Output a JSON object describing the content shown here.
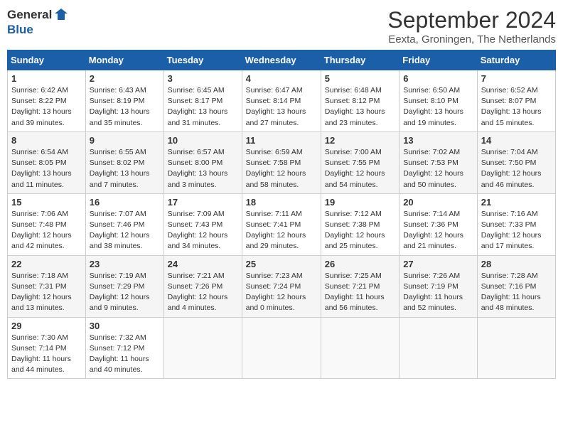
{
  "logo": {
    "line1": "General",
    "line2": "Blue"
  },
  "title": "September 2024",
  "location": "Eexta, Groningen, The Netherlands",
  "weekdays": [
    "Sunday",
    "Monday",
    "Tuesday",
    "Wednesday",
    "Thursday",
    "Friday",
    "Saturday"
  ],
  "weeks": [
    [
      {
        "day": "1",
        "info": "Sunrise: 6:42 AM\nSunset: 8:22 PM\nDaylight: 13 hours\nand 39 minutes."
      },
      {
        "day": "2",
        "info": "Sunrise: 6:43 AM\nSunset: 8:19 PM\nDaylight: 13 hours\nand 35 minutes."
      },
      {
        "day": "3",
        "info": "Sunrise: 6:45 AM\nSunset: 8:17 PM\nDaylight: 13 hours\nand 31 minutes."
      },
      {
        "day": "4",
        "info": "Sunrise: 6:47 AM\nSunset: 8:14 PM\nDaylight: 13 hours\nand 27 minutes."
      },
      {
        "day": "5",
        "info": "Sunrise: 6:48 AM\nSunset: 8:12 PM\nDaylight: 13 hours\nand 23 minutes."
      },
      {
        "day": "6",
        "info": "Sunrise: 6:50 AM\nSunset: 8:10 PM\nDaylight: 13 hours\nand 19 minutes."
      },
      {
        "day": "7",
        "info": "Sunrise: 6:52 AM\nSunset: 8:07 PM\nDaylight: 13 hours\nand 15 minutes."
      }
    ],
    [
      {
        "day": "8",
        "info": "Sunrise: 6:54 AM\nSunset: 8:05 PM\nDaylight: 13 hours\nand 11 minutes."
      },
      {
        "day": "9",
        "info": "Sunrise: 6:55 AM\nSunset: 8:02 PM\nDaylight: 13 hours\nand 7 minutes."
      },
      {
        "day": "10",
        "info": "Sunrise: 6:57 AM\nSunset: 8:00 PM\nDaylight: 13 hours\nand 3 minutes."
      },
      {
        "day": "11",
        "info": "Sunrise: 6:59 AM\nSunset: 7:58 PM\nDaylight: 12 hours\nand 58 minutes."
      },
      {
        "day": "12",
        "info": "Sunrise: 7:00 AM\nSunset: 7:55 PM\nDaylight: 12 hours\nand 54 minutes."
      },
      {
        "day": "13",
        "info": "Sunrise: 7:02 AM\nSunset: 7:53 PM\nDaylight: 12 hours\nand 50 minutes."
      },
      {
        "day": "14",
        "info": "Sunrise: 7:04 AM\nSunset: 7:50 PM\nDaylight: 12 hours\nand 46 minutes."
      }
    ],
    [
      {
        "day": "15",
        "info": "Sunrise: 7:06 AM\nSunset: 7:48 PM\nDaylight: 12 hours\nand 42 minutes."
      },
      {
        "day": "16",
        "info": "Sunrise: 7:07 AM\nSunset: 7:46 PM\nDaylight: 12 hours\nand 38 minutes."
      },
      {
        "day": "17",
        "info": "Sunrise: 7:09 AM\nSunset: 7:43 PM\nDaylight: 12 hours\nand 34 minutes."
      },
      {
        "day": "18",
        "info": "Sunrise: 7:11 AM\nSunset: 7:41 PM\nDaylight: 12 hours\nand 29 minutes."
      },
      {
        "day": "19",
        "info": "Sunrise: 7:12 AM\nSunset: 7:38 PM\nDaylight: 12 hours\nand 25 minutes."
      },
      {
        "day": "20",
        "info": "Sunrise: 7:14 AM\nSunset: 7:36 PM\nDaylight: 12 hours\nand 21 minutes."
      },
      {
        "day": "21",
        "info": "Sunrise: 7:16 AM\nSunset: 7:33 PM\nDaylight: 12 hours\nand 17 minutes."
      }
    ],
    [
      {
        "day": "22",
        "info": "Sunrise: 7:18 AM\nSunset: 7:31 PM\nDaylight: 12 hours\nand 13 minutes."
      },
      {
        "day": "23",
        "info": "Sunrise: 7:19 AM\nSunset: 7:29 PM\nDaylight: 12 hours\nand 9 minutes."
      },
      {
        "day": "24",
        "info": "Sunrise: 7:21 AM\nSunset: 7:26 PM\nDaylight: 12 hours\nand 4 minutes."
      },
      {
        "day": "25",
        "info": "Sunrise: 7:23 AM\nSunset: 7:24 PM\nDaylight: 12 hours\nand 0 minutes."
      },
      {
        "day": "26",
        "info": "Sunrise: 7:25 AM\nSunset: 7:21 PM\nDaylight: 11 hours\nand 56 minutes."
      },
      {
        "day": "27",
        "info": "Sunrise: 7:26 AM\nSunset: 7:19 PM\nDaylight: 11 hours\nand 52 minutes."
      },
      {
        "day": "28",
        "info": "Sunrise: 7:28 AM\nSunset: 7:16 PM\nDaylight: 11 hours\nand 48 minutes."
      }
    ],
    [
      {
        "day": "29",
        "info": "Sunrise: 7:30 AM\nSunset: 7:14 PM\nDaylight: 11 hours\nand 44 minutes."
      },
      {
        "day": "30",
        "info": "Sunrise: 7:32 AM\nSunset: 7:12 PM\nDaylight: 11 hours\nand 40 minutes."
      },
      {
        "day": "",
        "info": ""
      },
      {
        "day": "",
        "info": ""
      },
      {
        "day": "",
        "info": ""
      },
      {
        "day": "",
        "info": ""
      },
      {
        "day": "",
        "info": ""
      }
    ]
  ]
}
